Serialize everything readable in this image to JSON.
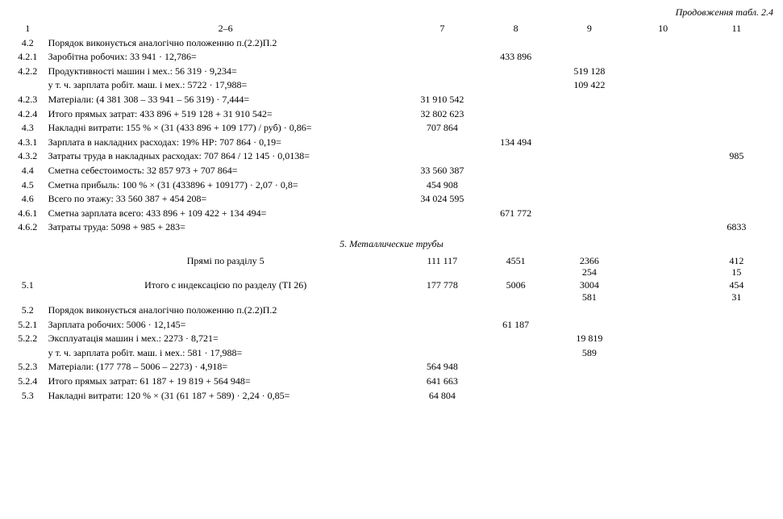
{
  "corner": "Продовження табл. 2.4",
  "headers": {
    "c1": "1",
    "c2": "2–6",
    "c7": "7",
    "c8": "8",
    "c9": "9",
    "c10": "10",
    "c11": "11"
  },
  "rows": [
    {
      "c1": "4.2",
      "c2": "Порядок виконується аналогічно положенню п.(2.2)П.2",
      "c7": "",
      "c8": "",
      "c9": "",
      "c10": "",
      "c11": ""
    },
    {
      "c1": "4.2.1",
      "c2": "Заробітна робочих: 33 941 · 12,786=",
      "c7": "",
      "c8": "433 896",
      "c9": "",
      "c10": "",
      "c11": ""
    },
    {
      "c1": "4.2.2",
      "c2": "Продуктивності машин і мех.: 56 319 · 9,234=",
      "c7": "",
      "c8": "",
      "c9": "519 128",
      "c10": "",
      "c11": ""
    },
    {
      "c1": "",
      "c2": "у т. ч. зарплата робіт. маш. і мех.: 5722 · 17,988=",
      "c7": "",
      "c8": "",
      "c9": "109 422",
      "c10": "",
      "c11": ""
    },
    {
      "c1": "4.2.3",
      "c2": "Матеріали: (4 381 308 – 33 941 – 56 319) · 7,444=",
      "c7": "31 910 542",
      "c8": "",
      "c9": "",
      "c10": "",
      "c11": ""
    },
    {
      "c1": "4.2.4",
      "c2": "Итого прямых затрат: 433 896 + 519 128 + 31 910 542=",
      "c7": "32 802 623",
      "c8": "",
      "c9": "",
      "c10": "",
      "c11": ""
    },
    {
      "c1": "4.3",
      "c2": "Накладні витрати: 155 % × (31 (433 896 + 109 177) / руб) · 0,86=",
      "c7": "707 864",
      "c8": "",
      "c9": "",
      "c10": "",
      "c11": ""
    },
    {
      "c1": "4.3.1",
      "c2": "Зарплата в накладних расходах: 19% НР: 707 864 · 0,19=",
      "c7": "",
      "c8": "134 494",
      "c9": "",
      "c10": "",
      "c11": ""
    },
    {
      "c1": "4.3.2",
      "c2": "Затраты труда в накладных расходах: 707 864 / 12 145 · 0,0138=",
      "c7": "",
      "c8": "",
      "c9": "",
      "c10": "",
      "c11": "985"
    },
    {
      "c1": "4.4",
      "c2": "Сметна себестоимость: 32 857 973 + 707 864=",
      "c7": "33 560 387",
      "c8": "",
      "c9": "",
      "c10": "",
      "c11": ""
    },
    {
      "c1": "4.5",
      "c2": "Сметна прибыль: 100 % × (31 (433896 + 109177) · 2,07 · 0,8=",
      "c7": "454 908",
      "c8": "",
      "c9": "",
      "c10": "",
      "c11": ""
    },
    {
      "c1": "4.6",
      "c2": "Всего по этажу: 33 560 387 + 454 208=",
      "c7": "34 024 595",
      "c8": "",
      "c9": "",
      "c10": "",
      "c11": ""
    },
    {
      "c1": "4.6.1",
      "c2": "Сметна зарплата всего: 433 896 + 109 422 + 134 494=",
      "c7": "",
      "c8": "671 772",
      "c9": "",
      "c10": "",
      "c11": ""
    },
    {
      "c1": "4.6.2",
      "c2": "Затраты труда: 5098 + 985 + 283=",
      "c7": "",
      "c8": "",
      "c9": "",
      "c10": "",
      "c11": "6833"
    }
  ],
  "section5": "5. Металлические трубы",
  "block": {
    "r1": {
      "c2": "Прямі по разділу 5",
      "c7": "111 117",
      "c8": "4551",
      "c9a": "2366",
      "c9b": "254",
      "c11a": "412",
      "c11b": "15"
    },
    "r2": {
      "c1": "5.1",
      "c2": "Итого с индексацією по разделу (ТІ 26)",
      "c7": "177 778",
      "c8": "5006",
      "c9a": "3004",
      "c9b": "581",
      "c11a": "454",
      "c11b": "31"
    }
  },
  "rows2": [
    {
      "c1": "5.2",
      "c2": "Порядок виконується аналогічно положенню п.(2.2)П.2",
      "c7": "",
      "c8": "",
      "c9": "",
      "c10": "",
      "c11": ""
    },
    {
      "c1": "5.2.1",
      "c2": "Зарплата робочих: 5006 · 12,145=",
      "c7": "",
      "c8": "61 187",
      "c9": "",
      "c10": "",
      "c11": ""
    },
    {
      "c1": "5.2.2",
      "c2": "Эксплуатація машин і мех.: 2273 · 8,721=",
      "c7": "",
      "c8": "",
      "c9": "19 819",
      "c10": "",
      "c11": ""
    },
    {
      "c1": "",
      "c2": "у т. ч. зарплата робіт. маш. і мех.: 581 · 17,988=",
      "c7": "",
      "c8": "",
      "c9": "589",
      "c10": "",
      "c11": ""
    },
    {
      "c1": "5.2.3",
      "c2": "Матеріали: (177 778 – 5006 – 2273) · 4,918=",
      "c7": "564 948",
      "c8": "",
      "c9": "",
      "c10": "",
      "c11": ""
    },
    {
      "c1": "5.2.4",
      "c2": "Итого прямых затрат: 61 187 + 19 819 + 564 948=",
      "c7": "641 663",
      "c8": "",
      "c9": "",
      "c10": "",
      "c11": ""
    },
    {
      "c1": "5.3",
      "c2": "Накладні витрати: 120 % × (31 (61 187 + 589) · 2,24 · 0,85=",
      "c7": "64 804",
      "c8": "",
      "c9": "",
      "c10": "",
      "c11": ""
    }
  ]
}
